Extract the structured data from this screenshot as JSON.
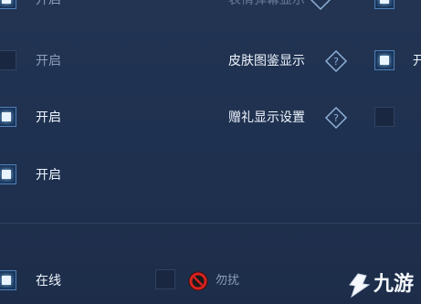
{
  "rows": {
    "row0_left_label": "开启",
    "row0_right_label": "表情弹幕显示",
    "row1_left_label": "开启",
    "row1_right_label": "皮肤图鉴显示",
    "row1_right_value": "开启",
    "row2_left_label": "开启",
    "row2_right_label": "赠礼显示设置",
    "row3_left_label": "开启"
  },
  "status": {
    "online_label": "在线",
    "dnd_label": "勿扰"
  },
  "watermark": {
    "text": "九游"
  },
  "states": {
    "row0_left": "checked",
    "row1_left": "unchecked",
    "row1_right": "checked",
    "row2_left": "checked",
    "row2_right": "unchecked",
    "row3_left": "checked",
    "online": "checked",
    "dnd": "unchecked"
  },
  "colors": {
    "background": "#1f3150",
    "accent": "#e9f4ff",
    "text": "#eef4fc",
    "dim_text": "#8a9db8",
    "dnd_red": "#d7221f"
  },
  "icons": {
    "help": "help-diamond-icon",
    "dnd": "no-entry-icon",
    "watermark": "jiuyou-logo-icon"
  }
}
